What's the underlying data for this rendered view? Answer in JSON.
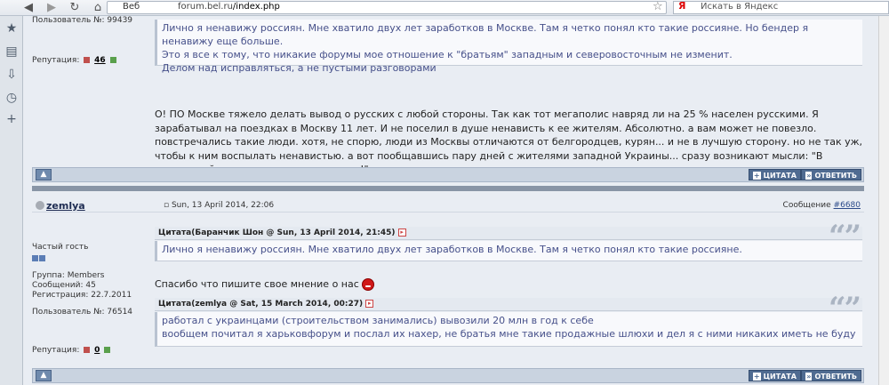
{
  "browser": {
    "tab_label": "Веб",
    "url": "forum.bel.ru/index.php",
    "url_host": "forum.bel.ru",
    "url_path": "/index.php",
    "search_placeholder": "Искать в Яндекс",
    "search_engine_logo": "Я"
  },
  "post1": {
    "profile": {
      "user_no": "Пользователь №: 99439",
      "rep_label": "Репутация:",
      "rep_value": "46"
    },
    "quote_lines": [
      "Лично я ненавижу россиян. Мне хватило двух лет заработков в Москве. Там я четко понял кто такие россияне. Но бендер я ненавижу еще больше.",
      "Это я все к тому, что никакие форумы мое отношение к \"братьям\" западным и северовосточным не изменит.",
      "Делом над исправляться, а не пустыми разговорами"
    ],
    "body": "О! ПО Москве тяжело делать вывод о русских с любой стороны. Так как тот мегаполис навряд ли на 25 % населен русскими. Я зарабатывал на поездках в Москву 11 лет. И не поселил в душе ненависть к ее жителям. Абсолютно. а вам может не повезло. повстречались такие люди. хотя, не спорю, люди из Москвы отличаются от белгородцев, курян... и не в лучшую сторону. но не так уж, чтобы к ним воспылать ненавистью. а вот пообщавшись пару дней с жителями западной Украины... сразу возникают мысли: \"В следующий раз надо захватить волыну!\" вот как-то так...",
    "quote_btn": "ЦИТАТА",
    "reply_btn": "ОТВЕТИТЬ"
  },
  "post2": {
    "username": "zemlya",
    "date": "Sun, 13 April 2014, 22:06",
    "msg_label": "Сообщение",
    "msg_no": "#6680",
    "profile": {
      "rank": "Частый гость",
      "group": "Группа: Members",
      "posts": "Сообщений: 45",
      "reg": "Регистрация: 22.7.2011",
      "user_no": "Пользователь №: 76514",
      "rep_label": "Репутация:",
      "rep_value": "0"
    },
    "quote1_head": "Цитата(Баранчик Шон @ Sun, 13 April 2014, 21:45)",
    "quote1_text": "Лично я ненавижу россиян. Мне хватило двух лет заработков в Москве. Там я четко понял кто такие россияне.",
    "reply_text": "Спасибо что пишите свое мнение о нас",
    "quote2_head": "Цитата(zemlya @ Sat, 15 March 2014, 00:27)",
    "quote2_lines": [
      "работал с украинцами (строительством занимались) вывозили 20 млн в год к себе",
      "вообщем почитал я харьковфорум и послал их нахер, не братья мне такие продажные шлюхи и дел я с ними никаких иметь не буду"
    ],
    "quote_btn": "ЦИТАТА",
    "reply_btn": "ОТВЕТИТЬ"
  },
  "colors": {
    "quote_text": "#46508a",
    "action_button": "#4f6b91",
    "separator": "#8995a6"
  }
}
